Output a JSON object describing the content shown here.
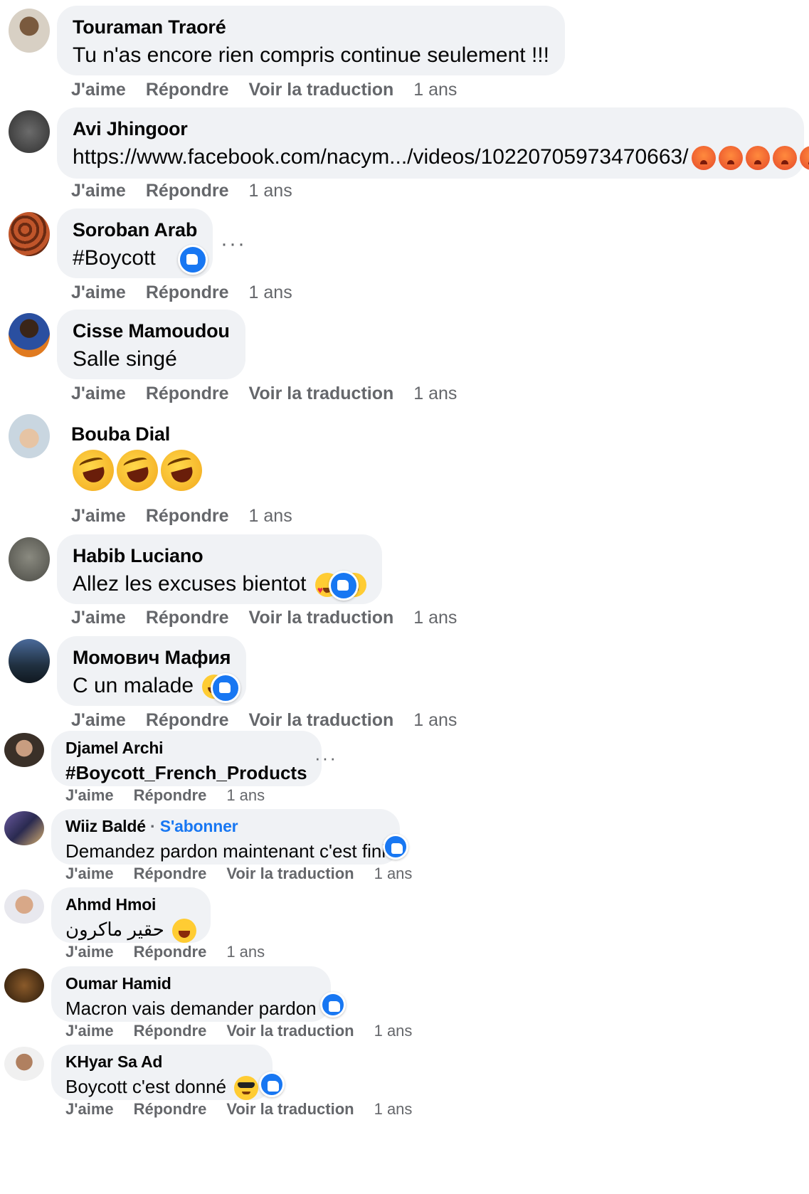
{
  "actions": {
    "like": "J'aime",
    "reply": "Répondre",
    "translate": "Voir la traduction"
  },
  "more": "···",
  "comments": [
    {
      "name": "Touraman Traoré",
      "text": "Tu n'as encore rien compris continue seulement !!!",
      "time": "1 ans"
    },
    {
      "name": "Avi Jhingoor",
      "text": "https://www.facebook.com/nacym.../videos/10220705973470663/",
      "time": "1 ans"
    },
    {
      "name": "Soroban Arab",
      "text": "#Boycott",
      "time": "1 ans"
    },
    {
      "name": "Cisse Mamoudou",
      "text": "Salle singé",
      "time": "1 ans"
    },
    {
      "name": "Bouba Dial",
      "text": "",
      "time": "1 ans"
    },
    {
      "name": "Habib Luciano",
      "text": "Allez les excuses bientot",
      "time": "1 ans"
    },
    {
      "name": "Момович Мафия",
      "text": "C un malade",
      "time": "1 ans"
    },
    {
      "name": "Djamel Archi",
      "text": "#Boycott_French_Products",
      "time": "1 ans"
    },
    {
      "name": "Wiiz Baldé",
      "follow": "S'abonner",
      "text": "Demandez pardon maintenant c'est fini",
      "time": "1 ans"
    },
    {
      "name": "Ahmd Hmoi",
      "text": "حقير ماكرون",
      "time": "1 ans"
    },
    {
      "name": "Oumar Hamid",
      "text": "Macron vais demander pardon",
      "time": "1 ans"
    },
    {
      "name": "KHyar Sa Ad",
      "text": "Boycott c'est donné",
      "time": "1 ans"
    }
  ],
  "icons": {
    "like_badge": "like-reaction-icon",
    "more": "more-options-icon"
  },
  "colors": {
    "bubble": "#f0f2f5",
    "accent": "#1877f2",
    "meta": "#65676b"
  }
}
